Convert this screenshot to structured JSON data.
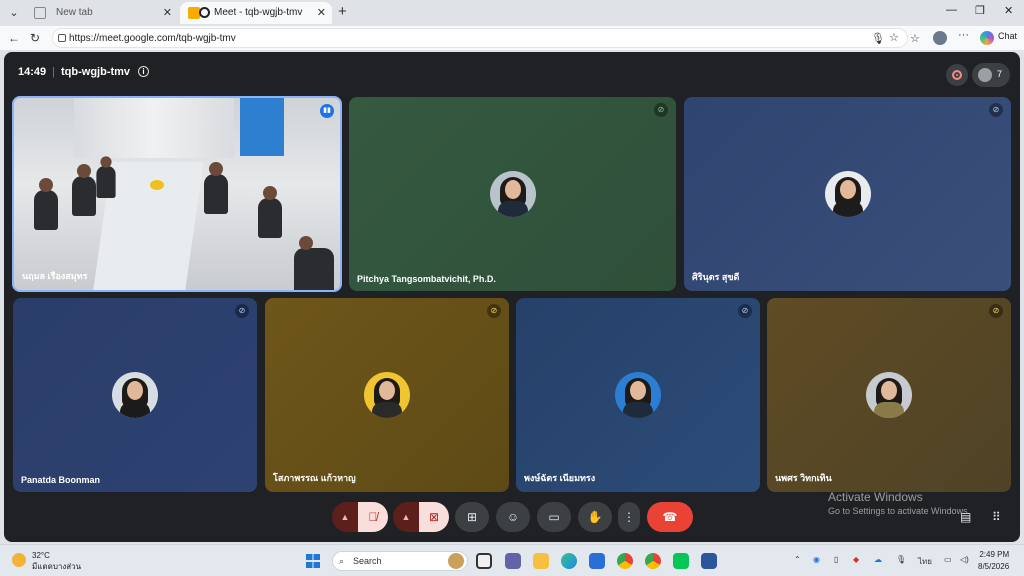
{
  "browser": {
    "tabs": [
      {
        "title": "New tab",
        "active": false
      },
      {
        "title": "Meet - tqb-wgjb-tmv",
        "active": true
      }
    ],
    "url": "https://meet.google.com/tqb-wgjb-tmv",
    "chat_label": "Chat"
  },
  "meeting": {
    "time": "14:49",
    "code": "tqb-wgjb-tmv",
    "participant_count": "7"
  },
  "participants": [
    {
      "name": "นฤมล เรืองสมุทร",
      "speaking": true,
      "muted": false,
      "bg": "video"
    },
    {
      "name": "Pitchya Tangsombatvichit, Ph.D.",
      "muted": true,
      "bg": "#3b5e45"
    },
    {
      "name": "ศิรินุตร สุขดี",
      "muted": true,
      "bg": "#34496e"
    },
    {
      "name": "Panatda Boonman",
      "muted": true,
      "bg": "#2e4272"
    },
    {
      "name": "โสภาพรรณ แก้วหาญ",
      "muted": true,
      "bg": "#6a5418"
    },
    {
      "name": "พงษ์ฉัตร เนียมทรง",
      "muted": true,
      "bg": "#2a4670"
    },
    {
      "name": "นพศร วิทกเทิน",
      "muted": true,
      "bg": "#5c4a26"
    }
  ],
  "controls": [
    "mic-toggle",
    "camera-toggle",
    "present",
    "reactions",
    "captions",
    "raise-hand",
    "more-options",
    "leave-call"
  ],
  "watermark": {
    "line1": "Activate Windows",
    "line2": "Go to Settings to activate Windows."
  },
  "taskbar": {
    "weather_temp": "32°C",
    "weather_desc": "มีแดดบางส่วน",
    "search_placeholder": "Search",
    "language": "ไทย",
    "time": "2:49 PM",
    "date": "8/5/2026"
  },
  "colors": {
    "meet_bg": "#202124",
    "control_bg": "#3c4043",
    "muted_control": "#f9dedc",
    "hangup": "#ea4335",
    "speaking_border": "#8ab4f8"
  }
}
